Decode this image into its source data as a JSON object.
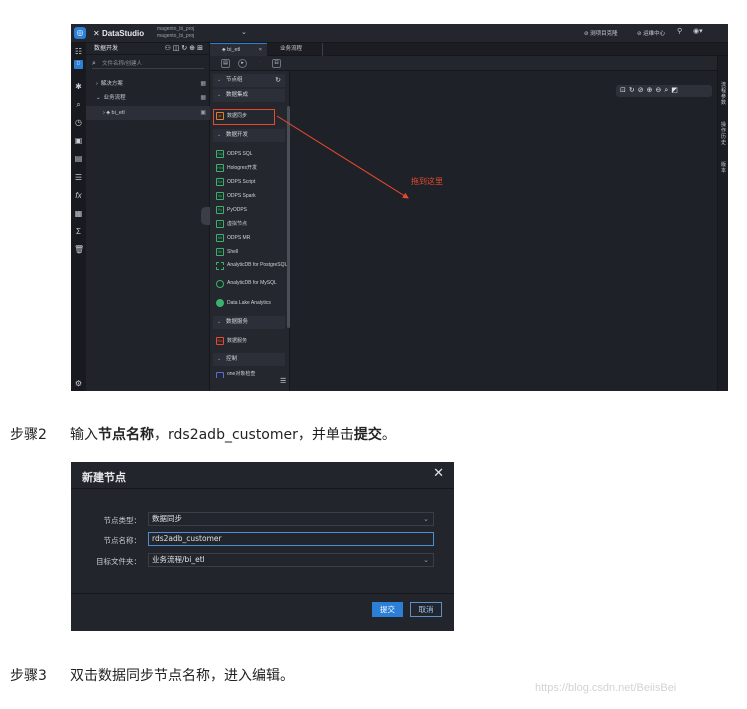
{
  "screenshot1": {
    "app": "DataStudio",
    "projects": [
      "magento_bi_proj",
      "magento_bi_proj"
    ],
    "top_actions": [
      "测项目克隆",
      "运维中心"
    ],
    "panel_title": "数据开发",
    "search_placeholder": "文件名称/创建人",
    "tree": [
      "解决方案",
      "业务流程",
      "bi_etl"
    ],
    "tabs": [
      "bi_etl",
      "业务流程"
    ],
    "palette_groups": [
      "节点组",
      "数据集成",
      "数据开发",
      "数据服务",
      "控制"
    ],
    "integration_item": "数据同步",
    "dev_items": [
      {
        "badge": "Sql",
        "label": "ODPS SQL"
      },
      {
        "badge": "Hol",
        "label": "Hologres开发"
      },
      {
        "badge": "Scr",
        "label": "ODPS Script"
      },
      {
        "badge": "Sp",
        "label": "ODPS Spark"
      },
      {
        "badge": "Py",
        "label": "PyODPS"
      },
      {
        "badge": "V",
        "label": "虚拟节点"
      },
      {
        "badge": "Mr",
        "label": "ODPS MR"
      },
      {
        "badge": "Sh",
        "label": "Shell"
      },
      {
        "badge": "",
        "label": "AnalyticDB for PostgreSQL"
      },
      {
        "badge": "",
        "label": "AnalyticDB for MySQL"
      },
      {
        "badge": "",
        "label": "Data Lake Analytics"
      }
    ],
    "service_item": "数据服务",
    "control_item": "one对象检查",
    "annotation": "拖到这里",
    "right_bar": [
      "流程参数",
      "操作历史",
      "版本"
    ]
  },
  "step2": {
    "num": "步骤2",
    "t1": "输入",
    "b1": "节点名称",
    "t2": "，rds2adb_customer，并单击",
    "b2": "提交",
    "t3": "。"
  },
  "dialog": {
    "title": "新建节点",
    "type_label": "节点类型：",
    "type_value": "数据同步",
    "name_label": "节点名称：",
    "name_value": "rds2adb_customer",
    "folder_label": "目标文件夹：",
    "folder_value": "业务流程/bi_etl",
    "submit": "提交",
    "cancel": "取消"
  },
  "step3": {
    "num": "步骤3",
    "text": "双击数据同步节点名称，进入编辑。"
  },
  "watermark": "https://blog.csdn.net/BeiisBei",
  "colors": {
    "accent": "#2b7fd6",
    "annotation": "#e64a2e",
    "panel_bg": "#1e2127"
  }
}
